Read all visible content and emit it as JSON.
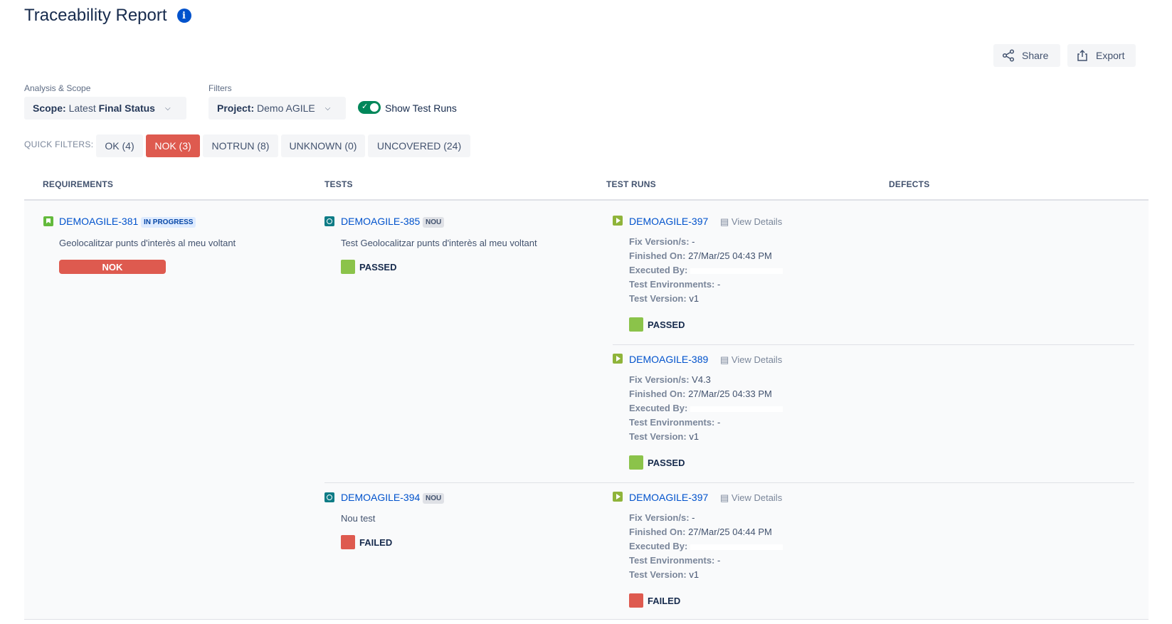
{
  "page": {
    "title": "Traceability Report"
  },
  "toolbar": {
    "share_label": "Share",
    "export_label": "Export"
  },
  "analysis": {
    "label": "Analysis & Scope",
    "scope_key": "Scope:",
    "scope_mid": " Latest ",
    "scope_value": "Final Status"
  },
  "filters": {
    "label": "Filters",
    "project_key": "Project:",
    "project_value": " Demo AGILE"
  },
  "show_test_runs": {
    "label": "Show Test Runs",
    "enabled": true
  },
  "quick_filters": {
    "label": "QUICK FILTERS:",
    "chips": [
      {
        "label": "OK (4)",
        "active": false
      },
      {
        "label": "NOK (3)",
        "active": true
      },
      {
        "label": "NOTRUN (8)",
        "active": false
      },
      {
        "label": "UNKNOWN (0)",
        "active": false
      },
      {
        "label": "UNCOVERED (24)",
        "active": false
      }
    ]
  },
  "columns": [
    "REQUIREMENTS",
    "TESTS",
    "TEST RUNS",
    "DEFECTS"
  ],
  "requirement": {
    "key": "DEMOAGILE-381",
    "status": "IN PROGRESS",
    "summary": "Geolocalitzar punts d'interès al meu voltant",
    "result": "NOK"
  },
  "tests": [
    {
      "key": "DEMOAGILE-385",
      "status": "NOU",
      "summary": "Test Geolocalitzar punts d'interès al meu voltant",
      "result": "PASSED"
    },
    {
      "key": "DEMOAGILE-394",
      "status": "NOU",
      "summary": "Nou test",
      "result": "FAILED"
    }
  ],
  "view_details_label": "View Details",
  "meta_labels": {
    "fix_version": "Fix Version/s:",
    "finished_on": "Finished On:",
    "executed_by": "Executed By:",
    "test_environments": "Test Environments:",
    "test_version": "Test Version:"
  },
  "runs": [
    {
      "key": "DEMOAGILE-397",
      "fix_version": "-",
      "finished_on": "27/Mar/25 04:43 PM",
      "test_environments": "-",
      "test_version": "v1",
      "result": "PASSED"
    },
    {
      "key": "DEMOAGILE-389",
      "fix_version": "V4.3",
      "finished_on": "27/Mar/25 04:33 PM",
      "test_environments": "-",
      "test_version": "v1",
      "result": "PASSED"
    },
    {
      "key": "DEMOAGILE-397",
      "fix_version": "-",
      "finished_on": "27/Mar/25 04:44 PM",
      "test_environments": "-",
      "test_version": "v1",
      "result": "FAILED"
    }
  ],
  "colors": {
    "accent": "#0052cc",
    "nok": "#de5a4f",
    "passed": "#8bc34a",
    "failed": "#de5a4f",
    "toggle_on": "#00875a"
  }
}
